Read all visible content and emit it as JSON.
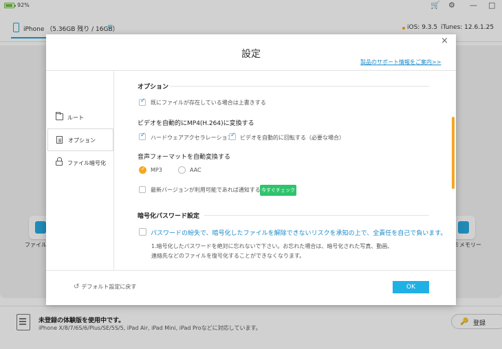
{
  "titlebar": {
    "battery": "92%",
    "cart_icon": "cart-icon",
    "settings_icon": "gear-icon",
    "min": "—",
    "max": "□"
  },
  "device": {
    "name": "iPhone （5.36GB 残り / 16GB）",
    "menu": "≡",
    "ios": "iOS: 9.3.5",
    "itunes": "iTunes: 12.6.1.25"
  },
  "tools": {
    "left_label": "ファイル暗",
    "right_label": "ミメモリー"
  },
  "footer": {
    "trial_title": "未登録の体験版を使用中です。",
    "trial_sub": "iPhone X/8/7/6S/6/Plus/SE/5S/5, iPad Air, iPad Mini, iPad Proなどに対応しています。",
    "register": "登録"
  },
  "dialog": {
    "title": "設定",
    "close": "×",
    "support_link": "製品のサポート情報をご案内>>",
    "nav": [
      {
        "label": "ルート"
      },
      {
        "label": "オプション"
      },
      {
        "label": "ファイル暗号化"
      }
    ],
    "options": {
      "section_title": "オプション",
      "overwrite": "既にファイルが存在している場合は上書きする",
      "video_title": "ビデオを自動的にMP4(H.264)に変換する",
      "hw_accel": "ハードウェアアクセラレーション",
      "auto_rotate": "ビデオを自動的に回転する（必要な場合）",
      "audio_title": "音声フォーマットを自動変換する",
      "mp3": "MP3",
      "aac": "AAC",
      "notify": "最新バージョンが利用可能であれば通知する。",
      "check_now": "今すぐチェック"
    },
    "encryption": {
      "section_title": "暗号化パスワード設定",
      "warning": "パスワードの紛失で、暗号化したファイルを解除できないリスクを承知の上で、全責任を自己で負います。",
      "note_line1": "1.暗号化したパスワードを絶対に忘れないで下さい。お忘れた場合は、暗号化された写真、動画、",
      "note_line2": "連絡先などのファイルを復号化することができなくなります。"
    },
    "restore_default": "デフォルト設定に戻す",
    "ok": "OK"
  }
}
